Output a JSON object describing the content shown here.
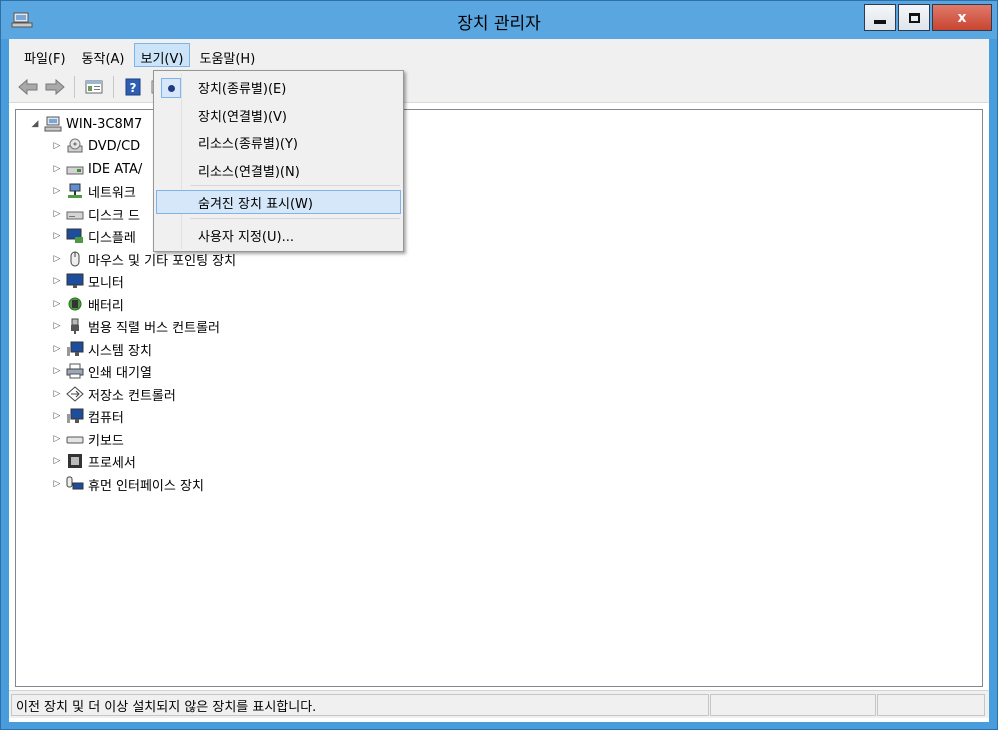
{
  "window": {
    "title": "장치 관리자",
    "close_glyph": "x"
  },
  "menubar": {
    "items": [
      "파일(F)",
      "동작(A)",
      "보기(V)",
      "도움말(H)"
    ]
  },
  "toolbar": {
    "icons": [
      "back-arrow-icon",
      "forward-arrow-icon",
      "properties-icon",
      "help-icon",
      "view-icon"
    ]
  },
  "tree": {
    "root": "WIN-3C8M7",
    "items": [
      {
        "label": "DVD/CD",
        "icon": "dvd-drive-icon"
      },
      {
        "label": "IDE ATA/",
        "icon": "ide-controller-icon"
      },
      {
        "label": "네트워크",
        "icon": "network-adapter-icon"
      },
      {
        "label": "디스크 드",
        "icon": "disk-drive-icon"
      },
      {
        "label": "디스플레",
        "icon": "display-adapter-icon"
      },
      {
        "label": "마우스 및 기타 포인팅 장치",
        "icon": "mouse-icon"
      },
      {
        "label": "모니터",
        "icon": "monitor-icon"
      },
      {
        "label": "배터리",
        "icon": "battery-icon"
      },
      {
        "label": "범용 직렬 버스 컨트롤러",
        "icon": "usb-icon"
      },
      {
        "label": "시스템 장치",
        "icon": "system-device-icon"
      },
      {
        "label": "인쇄 대기열",
        "icon": "printer-icon"
      },
      {
        "label": "저장소 컨트롤러",
        "icon": "storage-controller-icon"
      },
      {
        "label": "컴퓨터",
        "icon": "computer-icon"
      },
      {
        "label": "키보드",
        "icon": "keyboard-icon"
      },
      {
        "label": "프로세서",
        "icon": "processor-icon"
      },
      {
        "label": "휴먼 인터페이스 장치",
        "icon": "hid-icon"
      }
    ]
  },
  "view_menu": {
    "items": [
      {
        "label": "장치(종류별)(E)",
        "checked": true
      },
      {
        "label": "장치(연결별)(V)"
      },
      {
        "label": "리소스(종류별)(Y)"
      },
      {
        "label": "리소스(연결별)(N)"
      },
      {
        "label": "숨겨진 장치 표시(W)",
        "highlighted": true
      },
      {
        "label": "사용자 지정(U)..."
      }
    ]
  },
  "statusbar": {
    "text": "이전 장치 및 더 이상 설치되지 않은 장치를 표시합니다."
  },
  "colors": {
    "titlebar": "#5aa6e0",
    "menu_highlight": "#cce4f7",
    "close_button": "#c9442f"
  }
}
